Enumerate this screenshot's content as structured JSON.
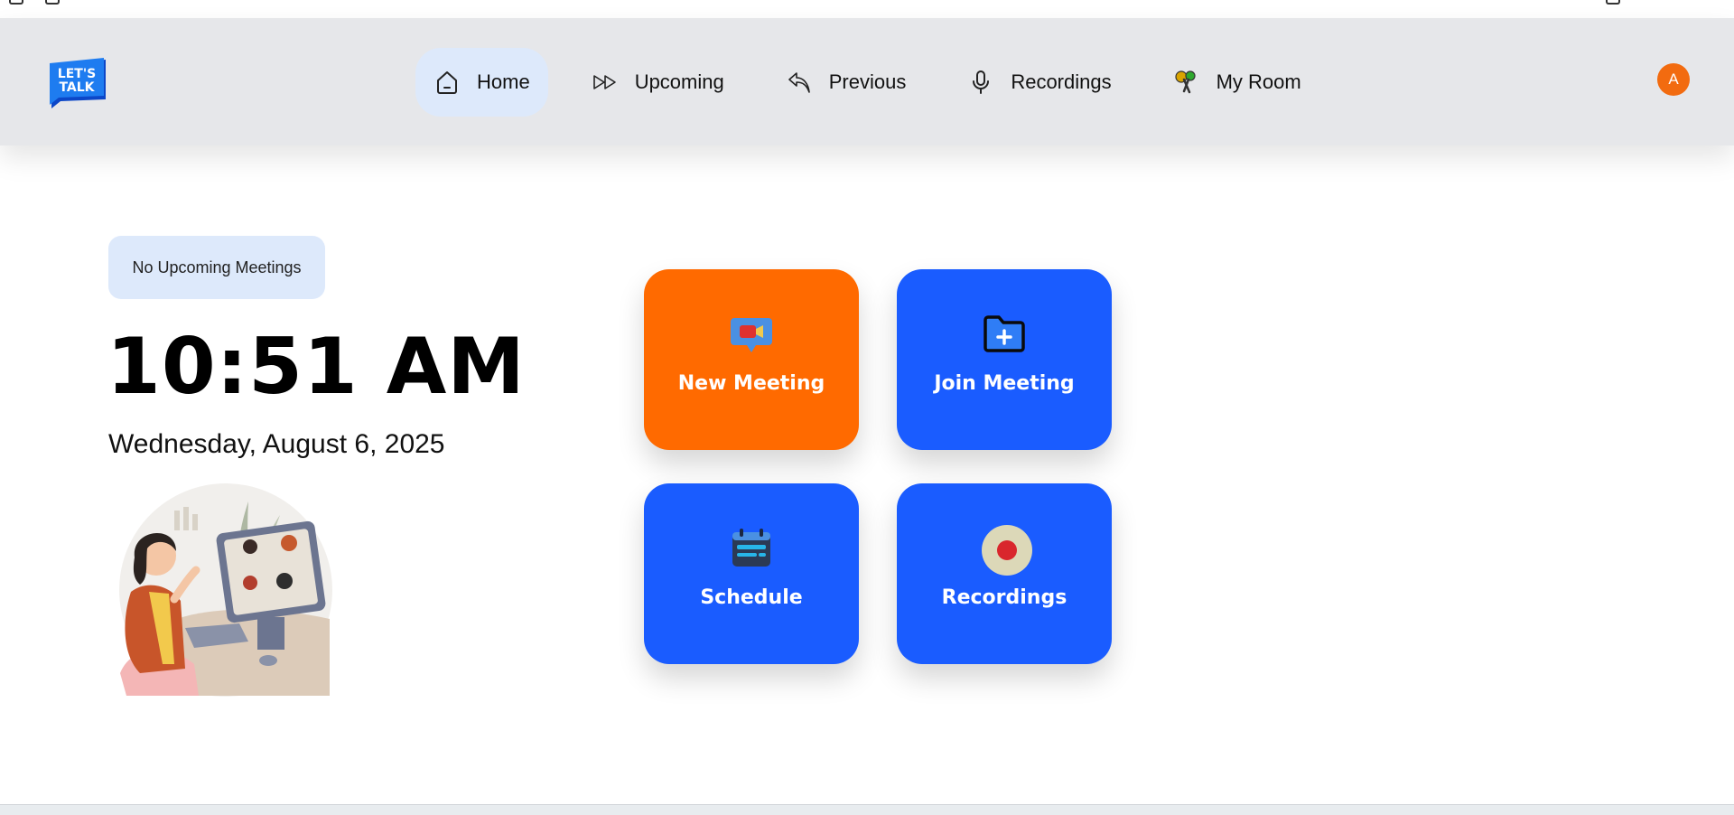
{
  "nav": {
    "items": [
      {
        "label": "Home",
        "icon": "home-icon",
        "active": true
      },
      {
        "label": "Upcoming",
        "icon": "fast-forward-icon",
        "active": false
      },
      {
        "label": "Previous",
        "icon": "previous-icon",
        "active": false
      },
      {
        "label": "Recordings",
        "icon": "microphone-icon",
        "active": false
      },
      {
        "label": "My Room",
        "icon": "keys-icon",
        "active": false
      }
    ]
  },
  "logo": {
    "line1": "LET'S",
    "line2": "TALK"
  },
  "avatar": {
    "initial": "A",
    "color": "#f26b10"
  },
  "status": {
    "badge": "No Upcoming Meetings"
  },
  "clock": {
    "time": "10:51 AM",
    "date": "Wednesday, August 6, 2025"
  },
  "cards": {
    "new_meeting": {
      "label": "New Meeting",
      "color": "#ff6a00",
      "icon": "video-chat-icon"
    },
    "join_meeting": {
      "label": "Join Meeting",
      "color": "#1a5cff",
      "icon": "folder-plus-icon"
    },
    "schedule": {
      "label": "Schedule",
      "color": "#1a5cff",
      "icon": "calendar-icon"
    },
    "recordings": {
      "label": "Recordings",
      "color": "#1a5cff",
      "icon": "record-icon"
    }
  },
  "colors": {
    "header_bg": "#e6e7ea",
    "active_nav_bg": "#dde9fb"
  }
}
